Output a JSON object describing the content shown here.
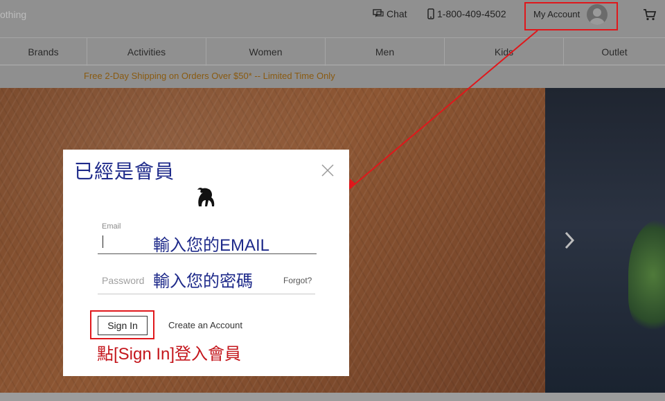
{
  "header": {
    "brand_partial": "othing",
    "chat_label": "Chat",
    "phone_number": "1-800-409-4502",
    "account_label": "My Account"
  },
  "nav": {
    "items": [
      "Brands",
      "Activities",
      "Women",
      "Men",
      "Kids",
      "Outlet"
    ]
  },
  "promo": {
    "text": "Free 2-Day Shipping on Orders Over $50* -- Limited Time Only"
  },
  "modal": {
    "title": "已經是會員",
    "email_label": "Email",
    "email_hint": "輸入您的EMAIL",
    "password_placeholder": "Password",
    "password_hint": "輸入您的密碼",
    "forgot_label": "Forgot?",
    "signin_label": "Sign In",
    "create_label": "Create an Account",
    "signin_hint": "點[Sign In]登入會員"
  },
  "colors": {
    "annotation": "#e0171b",
    "hint_text": "#1e2a8a",
    "promo_text": "#8a5a10"
  }
}
